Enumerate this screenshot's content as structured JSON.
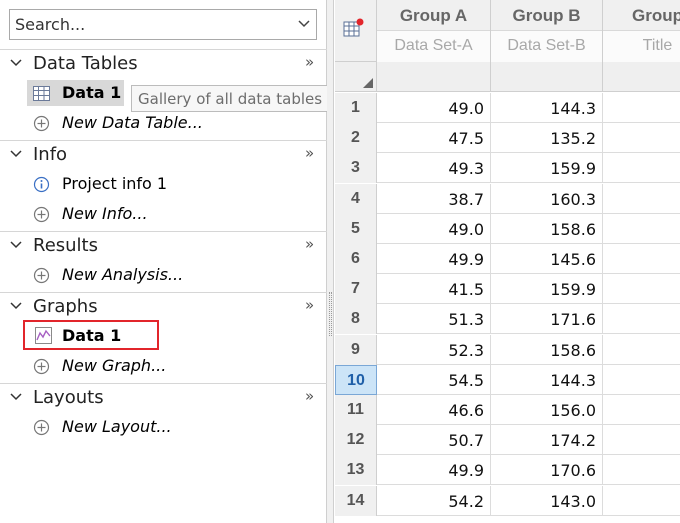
{
  "navigator": {
    "search": {
      "placeholder": "Search..."
    },
    "sections": {
      "data_tables": {
        "title": "Data Tables",
        "more": "»",
        "items": [
          {
            "label": "Data 1",
            "icon": "table-icon"
          },
          {
            "label": "New Data Table...",
            "icon": "plus-circle-icon"
          }
        ],
        "tooltip": "Gallery of all data tables"
      },
      "info": {
        "title": "Info",
        "more": "»",
        "items": [
          {
            "label": "Project info 1",
            "icon": "info-icon"
          },
          {
            "label": "New Info...",
            "icon": "plus-circle-icon"
          }
        ]
      },
      "results": {
        "title": "Results",
        "more": "»",
        "items": [
          {
            "label": "New Analysis...",
            "icon": "plus-circle-icon"
          }
        ]
      },
      "graphs": {
        "title": "Graphs",
        "more": "»",
        "items": [
          {
            "label": "Data 1",
            "icon": "graph-icon"
          },
          {
            "label": "New Graph...",
            "icon": "plus-circle-icon"
          }
        ]
      },
      "layouts": {
        "title": "Layouts",
        "more": "»",
        "items": [
          {
            "label": "New Layout...",
            "icon": "plus-circle-icon"
          }
        ]
      }
    },
    "highlight_color": "#e2252b"
  },
  "sheet": {
    "columns": [
      {
        "group": "Group A",
        "title": "Data Set-A"
      },
      {
        "group": "Group B",
        "title": "Data Set-B"
      },
      {
        "group": "Group",
        "title": "Title"
      }
    ],
    "rows": [
      {
        "num": "1",
        "a": "49.0",
        "b": "144.3"
      },
      {
        "num": "2",
        "a": "47.5",
        "b": "135.2"
      },
      {
        "num": "3",
        "a": "49.3",
        "b": "159.9"
      },
      {
        "num": "4",
        "a": "38.7",
        "b": "160.3"
      },
      {
        "num": "5",
        "a": "49.0",
        "b": "158.6"
      },
      {
        "num": "6",
        "a": "49.9",
        "b": "145.6"
      },
      {
        "num": "7",
        "a": "41.5",
        "b": "159.9"
      },
      {
        "num": "8",
        "a": "51.3",
        "b": "171.6"
      },
      {
        "num": "9",
        "a": "52.3",
        "b": "158.6"
      },
      {
        "num": "10",
        "a": "54.5",
        "b": "144.3"
      },
      {
        "num": "11",
        "a": "46.6",
        "b": "156.0"
      },
      {
        "num": "12",
        "a": "50.7",
        "b": "174.2"
      },
      {
        "num": "13",
        "a": "49.9",
        "b": "170.6"
      },
      {
        "num": "14",
        "a": "54.2",
        "b": "143.0"
      }
    ],
    "selected_row": "10",
    "selected_row_color": "#cce4f7"
  }
}
